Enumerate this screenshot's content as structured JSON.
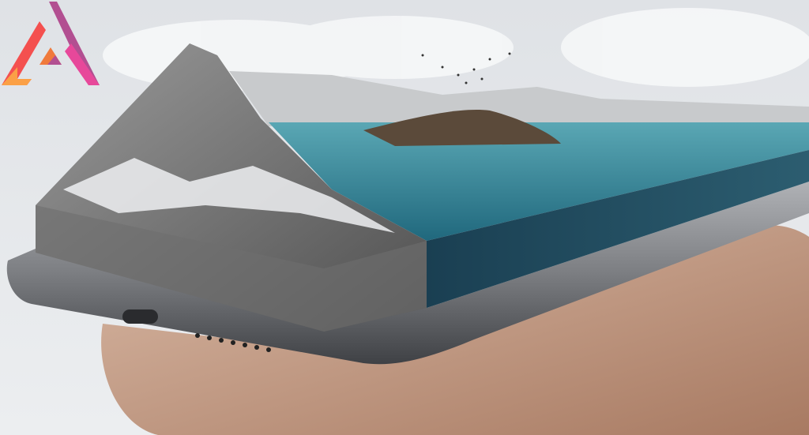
{
  "image": {
    "subject": "phone-with-landscape",
    "colors": {
      "sky": "#e4e6ea",
      "water": "#2f7f93",
      "water_deep": "#1d4a5c",
      "rock": "#7d7d7d",
      "snow": "#eef0f2",
      "phone": "#8a8c90",
      "skin": "#c9a48e"
    }
  },
  "logo": {
    "icon": "triangle-a-logo",
    "colors": [
      "#f4504f",
      "#fba046",
      "#b24f91",
      "#e7489a"
    ]
  }
}
